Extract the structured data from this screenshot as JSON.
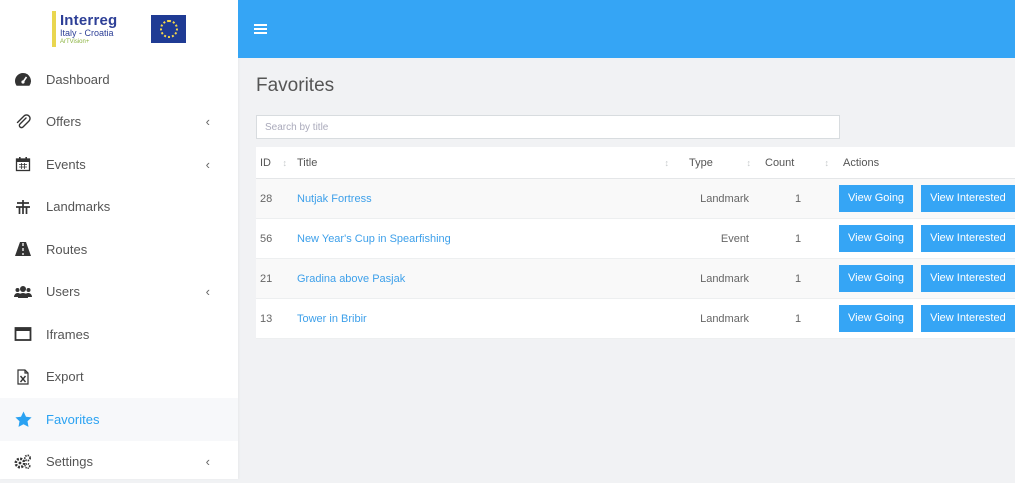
{
  "app": {
    "logo": {
      "name": "Interreg",
      "subtitle": "Italy - Croatia",
      "tagline": "ArTVision+"
    }
  },
  "sidebar": {
    "items": [
      {
        "label": "Dashboard",
        "icon": "tachometer-icon",
        "has_submenu": false,
        "active": false
      },
      {
        "label": "Offers",
        "icon": "paperclip-icon",
        "has_submenu": true,
        "active": false
      },
      {
        "label": "Events",
        "icon": "calendar-icon",
        "has_submenu": true,
        "active": false
      },
      {
        "label": "Landmarks",
        "icon": "landmark-icon",
        "has_submenu": false,
        "active": false
      },
      {
        "label": "Routes",
        "icon": "road-icon",
        "has_submenu": false,
        "active": false
      },
      {
        "label": "Users",
        "icon": "users-icon",
        "has_submenu": true,
        "active": false
      },
      {
        "label": "Iframes",
        "icon": "window-icon",
        "has_submenu": false,
        "active": false
      },
      {
        "label": "Export",
        "icon": "excel-file-icon",
        "has_submenu": false,
        "active": false
      },
      {
        "label": "Favorites",
        "icon": "star-icon",
        "has_submenu": false,
        "active": true
      },
      {
        "label": "Settings",
        "icon": "cogs-icon",
        "has_submenu": true,
        "active": false
      }
    ]
  },
  "colors": {
    "accent": "#35a5f5",
    "link": "#3ea0ea",
    "sidebar_bg": "#ffffff",
    "content_bg": "#f1f2f4"
  },
  "main": {
    "title": "Favorites",
    "search": {
      "placeholder": "Search by title",
      "value": ""
    },
    "table": {
      "columns": [
        "ID",
        "Title",
        "Type",
        "Count",
        "Actions"
      ],
      "rows": [
        {
          "id": "28",
          "title": "Nutjak Fortress",
          "type": "Landmark",
          "count": "1"
        },
        {
          "id": "56",
          "title": "New Year's Cup in Spearfishing",
          "type": "Event",
          "count": "1"
        },
        {
          "id": "21",
          "title": "Gradina above Pasjak",
          "type": "Landmark",
          "count": "1"
        },
        {
          "id": "13",
          "title": "Tower in Bribir",
          "type": "Landmark",
          "count": "1"
        }
      ],
      "action_labels": {
        "going": "View Going",
        "interested": "View Interested"
      }
    }
  }
}
